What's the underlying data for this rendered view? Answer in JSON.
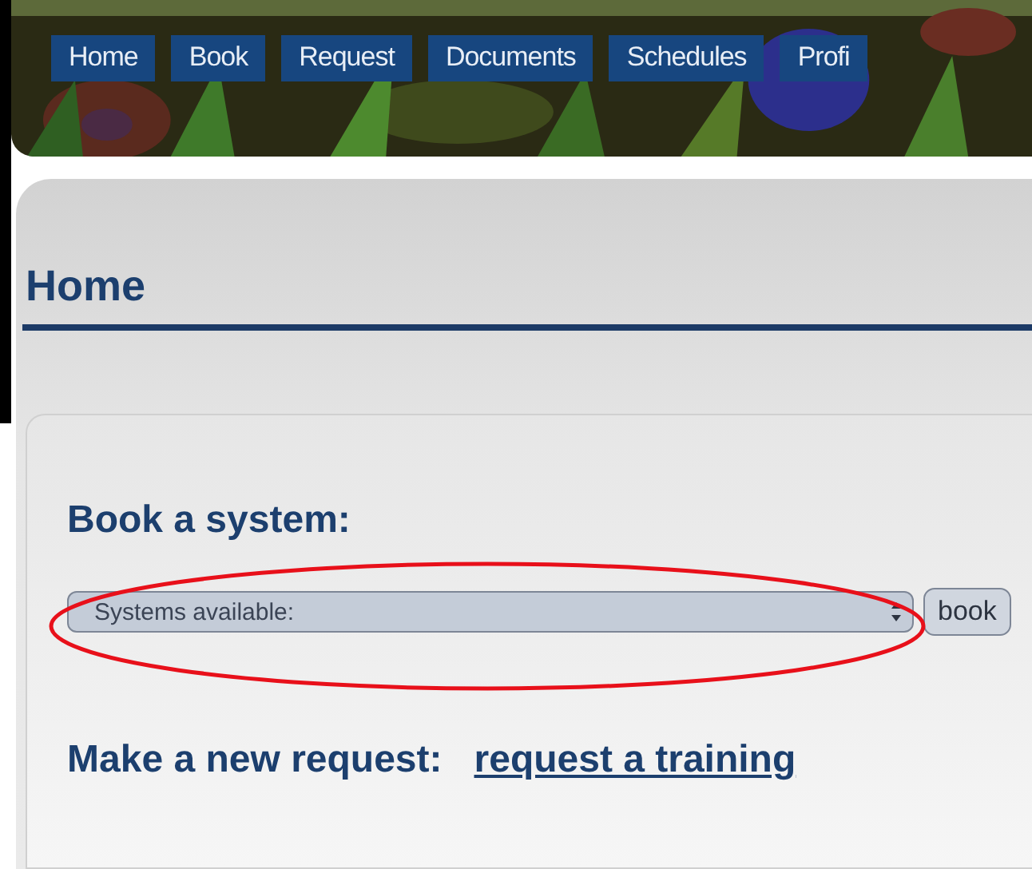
{
  "nav": {
    "tabs": [
      {
        "label": "Home"
      },
      {
        "label": "Book"
      },
      {
        "label": "Request"
      },
      {
        "label": "Documents"
      },
      {
        "label": "Schedules"
      },
      {
        "label": "Profi"
      }
    ]
  },
  "page": {
    "title": "Home"
  },
  "book": {
    "heading": "Book a system:",
    "select": {
      "value": "Systems available:"
    },
    "button": "book",
    "highlighted": true
  },
  "request": {
    "label": "Make a new request:",
    "link": "request a training"
  }
}
